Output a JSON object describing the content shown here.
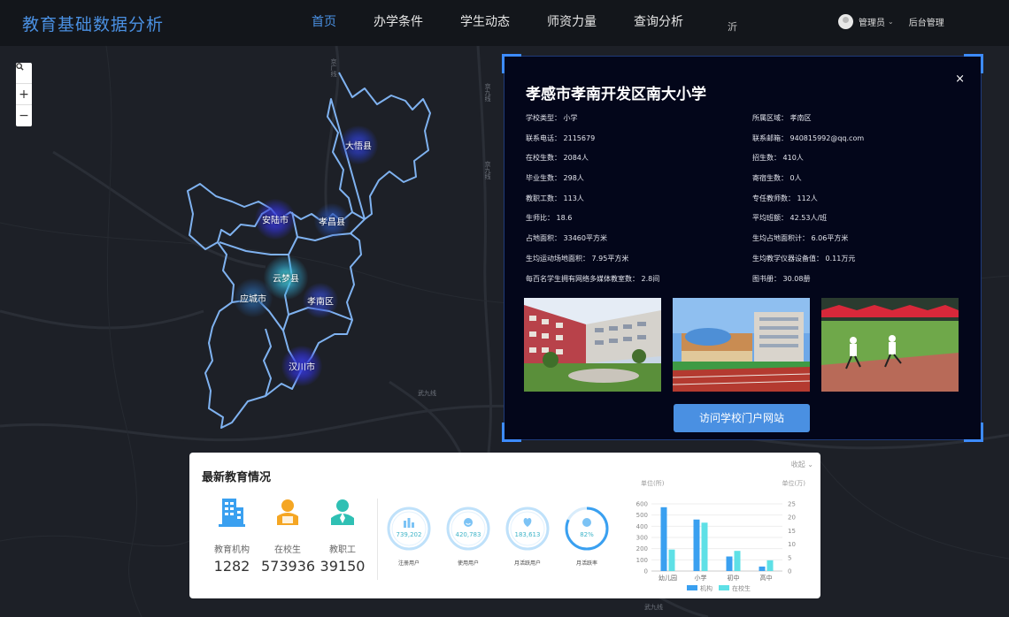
{
  "header": {
    "title": "教育基础数据分析",
    "nav": [
      "首页",
      "办学条件",
      "学生动态",
      "师资力量",
      "查询分析"
    ],
    "nav_extra": "沂",
    "user": "管理员",
    "admin_link": "后台管理"
  },
  "map": {
    "cities": [
      "大悟县",
      "安陆市",
      "孝昌县",
      "云梦县",
      "应城市",
      "孝南区",
      "汉川市"
    ],
    "roads": [
      "京九线",
      "武九线",
      "京广线"
    ]
  },
  "school": {
    "title": "孝感市孝南开发区南大小学",
    "close": "×",
    "info": [
      "学校类型：  小学",
      "所属区域：  孝南区",
      "联系电话：  2115679",
      "联系邮箱：  940815992@qq.com",
      "在校生数：  2084人",
      "招生数：  410人",
      "毕业生数：  298人",
      "寄宿生数：  0人",
      "教职工数：  113人",
      "专任教师数：  112人",
      "生师比：  18.6",
      "平均班额：  42.53人/班",
      "占地面积：  33460平方米",
      "生均占地面积计：  6.06平方米",
      "生均运动场地面积：  7.95平方米",
      "生均教学仪器设备值：  0.11万元",
      "每百名学生拥有网络多媒体教室数：  2.8间",
      "图书册：  30.08册"
    ],
    "button": "访问学校门户网站"
  },
  "stats": {
    "title": "最新教育情况",
    "collapse": "收起 ⌄",
    "items": [
      {
        "label": "教育机构",
        "value": "1282"
      },
      {
        "label": "在校生",
        "value": "573936"
      },
      {
        "label": "教职工",
        "value": "39150"
      }
    ],
    "rings": [
      {
        "label": "注册用户",
        "value": "739,202"
      },
      {
        "label": "使用用户",
        "value": "420,783"
      },
      {
        "label": "月活跃用户",
        "value": "183,613"
      },
      {
        "label": "月活跃率",
        "value": "82%"
      }
    ]
  },
  "chart_data": {
    "type": "bar",
    "categories": [
      "幼儿园",
      "小学",
      "初中",
      "高中"
    ],
    "series": [
      {
        "name": "机构",
        "values": [
          570,
          460,
          130,
          40
        ],
        "axis": "left"
      },
      {
        "name": "在校生",
        "values": [
          8,
          18,
          7.5,
          4
        ],
        "axis": "right"
      }
    ],
    "ylabel_left": "单位(所)",
    "ylabel_right": "单位(万)",
    "ylim_left": [
      0,
      600
    ],
    "ylim_right": [
      0,
      25
    ],
    "yticks_left": [
      0,
      100,
      200,
      300,
      400,
      500,
      600
    ],
    "yticks_right": [
      0,
      5,
      10,
      15,
      20,
      25
    ],
    "grid": true,
    "legend": "bottom",
    "colors": [
      "#3aa0f0",
      "#5ee0e6"
    ]
  },
  "colors": {
    "accent": "#4a90e2",
    "ring": "#7cc3f5",
    "ring_text": "#3fb4c8"
  }
}
